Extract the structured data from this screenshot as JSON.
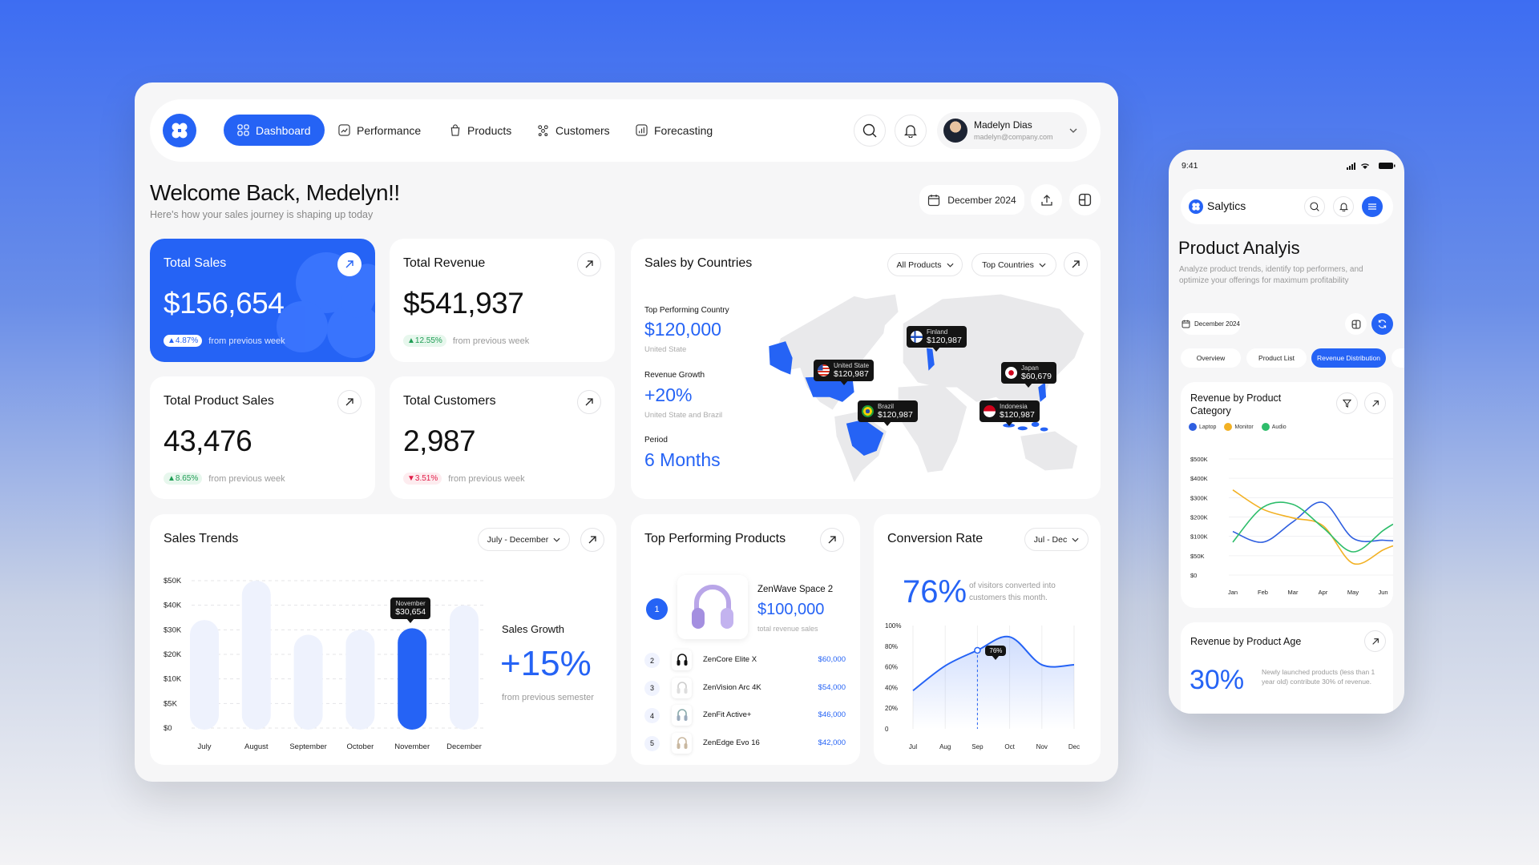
{
  "colors": {
    "accent": "#2563f5",
    "bar_light": "#eef2fd",
    "laptop": "#2f5fe0",
    "monitor": "#f2b124",
    "audio": "#2ebd6b",
    "up": "#1f9d55",
    "down": "#e11d48"
  },
  "nav": {
    "items": [
      {
        "label": "Dashboard",
        "icon": "grid-icon",
        "active": true
      },
      {
        "label": "Performance",
        "icon": "chart-icon"
      },
      {
        "label": "Products",
        "icon": "bag-icon"
      },
      {
        "label": "Customers",
        "icon": "users-icon"
      },
      {
        "label": "Forecasting",
        "icon": "forecast-icon"
      }
    ],
    "user": {
      "name": "Madelyn Dias",
      "email": "madelyn@company.com"
    }
  },
  "header": {
    "title": "Welcome Back, Medelyn!!",
    "subtitle": "Here's how your sales journey is shaping up today",
    "date": "December 2024"
  },
  "kpis": [
    {
      "title": "Total Sales",
      "value": "$156,654",
      "change": "4.87%",
      "direction": "up",
      "note": "from previous week"
    },
    {
      "title": "Total Revenue",
      "value": "$541,937",
      "change": "12.55%",
      "direction": "up",
      "note": "from previous week"
    },
    {
      "title": "Total Product Sales",
      "value": "43,476",
      "change": "8.65%",
      "direction": "up",
      "note": "from previous week"
    },
    {
      "title": "Total Customers",
      "value": "2,987",
      "change": "3.51%",
      "direction": "down",
      "note": "from previous week"
    }
  ],
  "countries": {
    "title": "Sales by Countries",
    "filter1": "All Products",
    "filter2": "Top Countries",
    "top_label": "Top Performing Country",
    "top_value": "$120,000",
    "top_country": "United State",
    "growth_label": "Revenue Growth",
    "growth_value": "+20%",
    "growth_note": "United State and Brazil",
    "period_label": "Period",
    "period_value": "6 Months",
    "markers": [
      {
        "name": "Finland",
        "value": "$120,987"
      },
      {
        "name": "United State",
        "value": "$120,987"
      },
      {
        "name": "Brazil",
        "value": "$120,987"
      },
      {
        "name": "Japan",
        "value": "$60,679"
      },
      {
        "name": "Indonesia",
        "value": "$120,987"
      }
    ]
  },
  "chart_data": [
    {
      "type": "bar",
      "title": "Sales Trends",
      "filter": "July - December",
      "categories": [
        "July",
        "August",
        "September",
        "October",
        "November",
        "December"
      ],
      "values": [
        34000,
        50000,
        28000,
        30000,
        30654,
        40000
      ],
      "highlight": "November",
      "tooltip": {
        "label": "November",
        "value": "$30,654"
      },
      "yticks": [
        "$50K",
        "$40K",
        "$30K",
        "$20K",
        "$10K",
        "$5K",
        "$0"
      ],
      "ytick_values": [
        50000,
        40000,
        30000,
        20000,
        10000,
        5000,
        0
      ],
      "grid": true,
      "side": {
        "label": "Sales Growth",
        "value": "+15%",
        "note": "from previous semester"
      }
    },
    {
      "type": "area",
      "title": "Conversion Rate",
      "filter": "Jul - Dec",
      "headline": "76%",
      "headline_note": "of visitors converted into customers this month.",
      "categories": [
        "Jul",
        "Aug",
        "Sep",
        "Oct",
        "Nov",
        "Dec"
      ],
      "values": [
        37,
        61,
        76,
        89,
        62,
        62
      ],
      "unit": "%",
      "ylim": [
        0,
        100
      ],
      "yticks": [
        "100%",
        "80%",
        "60%",
        "40%",
        "20%",
        "0"
      ],
      "tooltip": {
        "category": "Sep",
        "value": "76%"
      }
    },
    {
      "type": "line",
      "title": "Revenue by Product Category",
      "categories": [
        "Jan",
        "Feb",
        "Mar",
        "Apr",
        "May",
        "Jun"
      ],
      "yticks": [
        "$500K",
        "$400K",
        "$300K",
        "$200K",
        "$100K",
        "$50K",
        "$0"
      ],
      "ytick_values": [
        500,
        400,
        300,
        200,
        100,
        50,
        0
      ],
      "grid": true,
      "legend": "top-left",
      "series": [
        {
          "name": "Laptop",
          "values": [
            125,
            85,
            175,
            275,
            95,
            90
          ]
        },
        {
          "name": "Monitor",
          "values": [
            340,
            240,
            195,
            155,
            30,
            65
          ]
        },
        {
          "name": "Audio",
          "values": [
            85,
            250,
            265,
            145,
            60,
            130
          ]
        }
      ]
    }
  ],
  "top_products": {
    "title": "Top Performing Products",
    "featured": {
      "rank": "1",
      "name": "ZenWave Space 2",
      "value": "$100,000",
      "note": "total revenue sales"
    },
    "list": [
      {
        "rank": "2",
        "name": "ZenCore Elite X",
        "value": "$60,000"
      },
      {
        "rank": "3",
        "name": "ZenVision Arc 4K",
        "value": "$54,000"
      },
      {
        "rank": "4",
        "name": "ZenFit Active+",
        "value": "$46,000"
      },
      {
        "rank": "5",
        "name": "ZenEdge Evo 16",
        "value": "$42,000"
      }
    ]
  },
  "phone": {
    "time": "9:41",
    "app": "Salytics",
    "title": "Product Analyis",
    "desc": "Analyze product trends, identify top performers, and optimize your offerings for maximum profitability",
    "date": "December 2024",
    "tabs": [
      {
        "label": "Overview"
      },
      {
        "label": "Product List"
      },
      {
        "label": "Revenue Distribution",
        "active": true
      }
    ],
    "age": {
      "title": "Revenue by Product Age",
      "value": "30%",
      "note": "Newly launched products (less than 1 year old) contribute 30% of revenue."
    }
  }
}
